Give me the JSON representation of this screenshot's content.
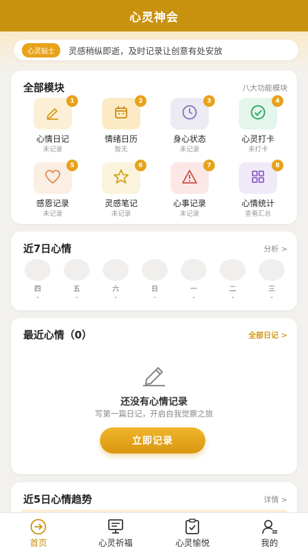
{
  "header": {
    "title": "心灵神会"
  },
  "tip": {
    "badge": "心灵贴士",
    "text": "灵感稍纵即逝，及时记录让创意有处安放"
  },
  "modules": {
    "title": "全部模块",
    "subtitle": "八大功能模块",
    "items": [
      {
        "num": "1",
        "name": "心情日记",
        "status": "未记录",
        "icon": "pencil-icon",
        "bg": "#fbf0d6",
        "color": "#d49a1a"
      },
      {
        "num": "2",
        "name": "情绪日历",
        "status": "暂无",
        "icon": "calendar-icon",
        "bg": "#fbeac4",
        "color": "#c98a12"
      },
      {
        "num": "3",
        "name": "身心状态",
        "status": "未记录",
        "icon": "clock-icon",
        "bg": "#ecebf4",
        "color": "#7b6fb8"
      },
      {
        "num": "4",
        "name": "心灵打卡",
        "status": "未打卡",
        "icon": "check-circle-icon",
        "bg": "#e4f5ec",
        "color": "#2eaa64"
      },
      {
        "num": "5",
        "name": "感恩记录",
        "status": "未记录",
        "icon": "heart-icon",
        "bg": "#fbeee2",
        "color": "#d88a52"
      },
      {
        "num": "6",
        "name": "灵感笔记",
        "status": "未记录",
        "icon": "star-icon",
        "bg": "#fbf3dc",
        "color": "#d4a21a"
      },
      {
        "num": "7",
        "name": "心事记录",
        "status": "未记录",
        "icon": "warning-icon",
        "bg": "#fbe8e6",
        "color": "#cc4a44"
      },
      {
        "num": "8",
        "name": "心情统计",
        "status": "查看汇总",
        "icon": "grid-icon",
        "bg": "#f0eaf8",
        "color": "#8a5cc4"
      }
    ]
  },
  "week": {
    "title": "近7日心情",
    "link": "分析 >",
    "days": [
      {
        "label": "四",
        "value": "-"
      },
      {
        "label": "五",
        "value": "-"
      },
      {
        "label": "六",
        "value": "-"
      },
      {
        "label": "日",
        "value": "-"
      },
      {
        "label": "一",
        "value": "-"
      },
      {
        "label": "二",
        "value": "-"
      },
      {
        "label": "三",
        "value": "-"
      }
    ]
  },
  "recent": {
    "title": "最近心情（0）",
    "link": "全部日记 >",
    "empty_title": "还没有心情记录",
    "empty_sub": "写第一篇日记，开启自我觉察之旅",
    "button": "立即记录"
  },
  "trend": {
    "title": "近5日心情趋势",
    "link": "详情 >"
  },
  "tabs": [
    {
      "label": "首页",
      "icon": "home-arrow-icon",
      "active": true
    },
    {
      "label": "心灵祈福",
      "icon": "monitor-icon",
      "active": false
    },
    {
      "label": "心灵愉悦",
      "icon": "clipboard-check-icon",
      "active": false
    },
    {
      "label": "我的",
      "icon": "user-icon",
      "active": false
    }
  ],
  "colors": {
    "brand": "#c9920e",
    "accent": "#e8a21a"
  }
}
